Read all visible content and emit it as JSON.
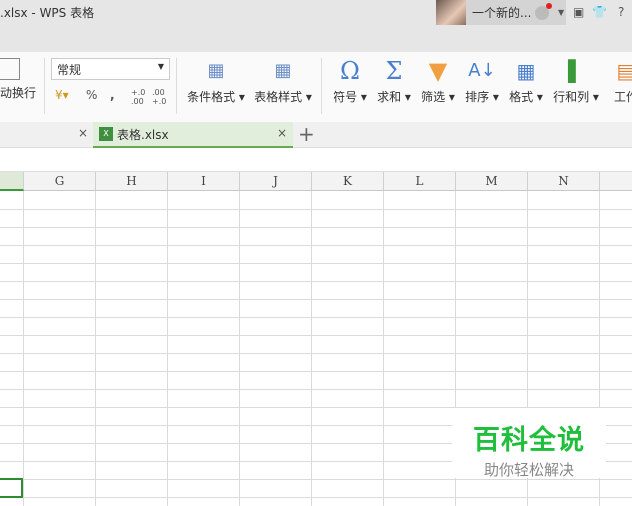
{
  "window": {
    "title": ".xlsx - WPS 表格",
    "user_name": "一个新的...",
    "skin_icon": "tshirt-icon",
    "help": "?"
  },
  "ribbon": {
    "wrap_label": "动换行",
    "number_format": "常规",
    "percent": "%",
    "comma": ",",
    "inc_decimal": "+.0\n.00",
    "dec_decimal": ".00\n+.0",
    "buttons": [
      {
        "label": "条件格式",
        "icon": "conditional-format-icon"
      },
      {
        "label": "表格样式",
        "icon": "table-style-icon"
      },
      {
        "label": "符号",
        "icon": "omega-icon"
      },
      {
        "label": "求和",
        "icon": "sigma-icon"
      },
      {
        "label": "筛选",
        "icon": "filter-icon"
      },
      {
        "label": "排序",
        "icon": "sort-icon"
      },
      {
        "label": "格式",
        "icon": "format-icon"
      },
      {
        "label": "行和列",
        "icon": "rows-cols-icon"
      },
      {
        "label": "工作",
        "icon": "worksheet-icon"
      }
    ]
  },
  "tabs": {
    "active": "表格.xlsx",
    "add": "+",
    "close": "×"
  },
  "columns": [
    "G",
    "H",
    "I",
    "J",
    "K",
    "L",
    "M",
    "N"
  ],
  "watermark": {
    "title": "百科全说",
    "subtitle": "助你轻松解决"
  }
}
